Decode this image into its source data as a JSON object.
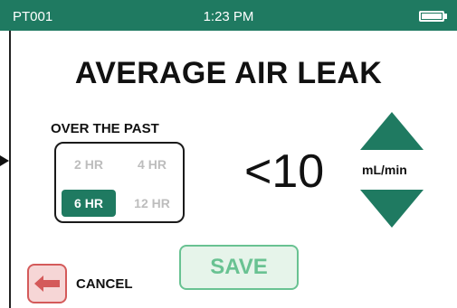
{
  "status_bar": {
    "device_id": "PT001",
    "time": "1:23 PM"
  },
  "screen": {
    "title": "AVERAGE AIR LEAK",
    "range_label": "OVER THE PAST",
    "ranges": [
      {
        "label": "2 HR",
        "selected": false
      },
      {
        "label": "4 HR",
        "selected": false
      },
      {
        "label": "6 HR",
        "selected": true
      },
      {
        "label": "12 HR",
        "selected": false
      }
    ],
    "value": "<10",
    "unit": "mL/min"
  },
  "actions": {
    "save_label": "SAVE",
    "cancel_label": "CANCEL"
  },
  "colors": {
    "primary": "#1f7a61",
    "save_border": "#69c292",
    "save_bg": "#e6f4ea",
    "cancel_border": "#d45a5a",
    "cancel_bg": "#f6d6d6"
  },
  "icons": {
    "battery": "battery-icon",
    "increase": "triangle-up-icon",
    "decrease": "triangle-down-icon",
    "cancel": "arrow-left-icon",
    "pointer": "side-pointer-icon"
  }
}
